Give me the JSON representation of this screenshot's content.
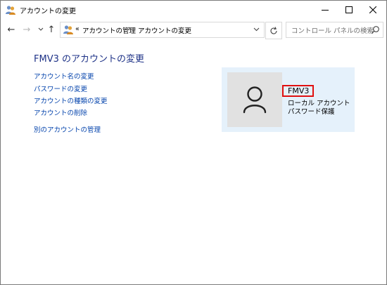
{
  "window": {
    "title": "アカウントの変更"
  },
  "address": {
    "overflow": "«",
    "breadcrumbs": [
      "アカウントの管理",
      "アカウントの変更"
    ]
  },
  "search": {
    "placeholder": "コントロール パネルの検索"
  },
  "main": {
    "heading": "FMV3 のアカウントの変更",
    "links": [
      "アカウント名の変更",
      "パスワードの変更",
      "アカウントの種類の変更",
      "アカウントの削除"
    ],
    "other_link": "別のアカウントの管理"
  },
  "account": {
    "name": "FMV3",
    "type": "ローカル アカウント",
    "password_status": "パスワード保護"
  },
  "colors": {
    "accent": "#1e3287",
    "link": "#0645ad",
    "card": "#e5f1fb",
    "highlight": "#e01010"
  }
}
